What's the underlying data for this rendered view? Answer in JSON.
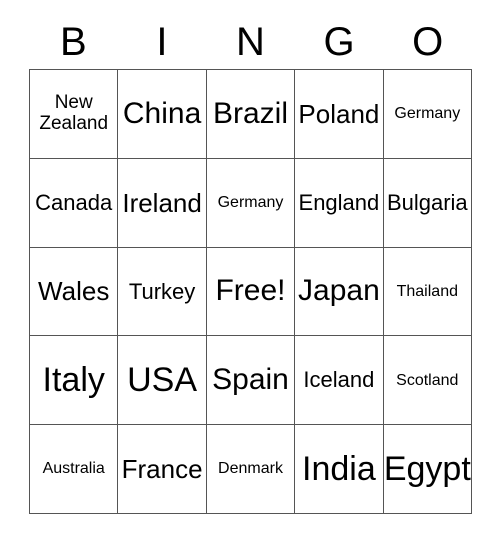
{
  "card": {
    "header_letters": [
      "B",
      "I",
      "N",
      "G",
      "O"
    ],
    "columns": 5,
    "rows": 5,
    "background_color": "#ffffff",
    "text_color": "#000000",
    "border_color": "#555555"
  },
  "cells": [
    {
      "text": "New Zealand",
      "size": "sm",
      "column": "B",
      "row": 1,
      "free": false
    },
    {
      "text": "China",
      "size": "xl",
      "column": "I",
      "row": 1,
      "free": false
    },
    {
      "text": "Brazil",
      "size": "xl",
      "column": "N",
      "row": 1,
      "free": false
    },
    {
      "text": "Poland",
      "size": "lg",
      "column": "G",
      "row": 1,
      "free": false
    },
    {
      "text": "Germany",
      "size": "xs",
      "column": "O",
      "row": 1,
      "free": false
    },
    {
      "text": "Canada",
      "size": "md",
      "column": "B",
      "row": 2,
      "free": false
    },
    {
      "text": "Ireland",
      "size": "lg",
      "column": "I",
      "row": 2,
      "free": false
    },
    {
      "text": "Germany",
      "size": "xs",
      "column": "N",
      "row": 2,
      "free": false
    },
    {
      "text": "England",
      "size": "md",
      "column": "G",
      "row": 2,
      "free": false
    },
    {
      "text": "Bulgaria",
      "size": "md",
      "column": "O",
      "row": 2,
      "free": false
    },
    {
      "text": "Wales",
      "size": "lg",
      "column": "B",
      "row": 3,
      "free": false
    },
    {
      "text": "Turkey",
      "size": "md",
      "column": "I",
      "row": 3,
      "free": false
    },
    {
      "text": "Free!",
      "size": "xl",
      "column": "N",
      "row": 3,
      "free": true
    },
    {
      "text": "Japan",
      "size": "xl",
      "column": "G",
      "row": 3,
      "free": false
    },
    {
      "text": "Thailand",
      "size": "xs",
      "column": "O",
      "row": 3,
      "free": false
    },
    {
      "text": "Italy",
      "size": "xxl",
      "column": "B",
      "row": 4,
      "free": false
    },
    {
      "text": "USA",
      "size": "xxl",
      "column": "I",
      "row": 4,
      "free": false
    },
    {
      "text": "Spain",
      "size": "xl",
      "column": "N",
      "row": 4,
      "free": false
    },
    {
      "text": "Iceland",
      "size": "md",
      "column": "G",
      "row": 4,
      "free": false
    },
    {
      "text": "Scotland",
      "size": "xs",
      "column": "O",
      "row": 4,
      "free": false
    },
    {
      "text": "Australia",
      "size": "xs",
      "column": "B",
      "row": 5,
      "free": false
    },
    {
      "text": "France",
      "size": "lg",
      "column": "I",
      "row": 5,
      "free": false
    },
    {
      "text": "Denmark",
      "size": "xs",
      "column": "N",
      "row": 5,
      "free": false
    },
    {
      "text": "India",
      "size": "xxl",
      "column": "G",
      "row": 5,
      "free": false
    },
    {
      "text": "Egypt",
      "size": "xxl",
      "column": "O",
      "row": 5,
      "free": false
    }
  ]
}
